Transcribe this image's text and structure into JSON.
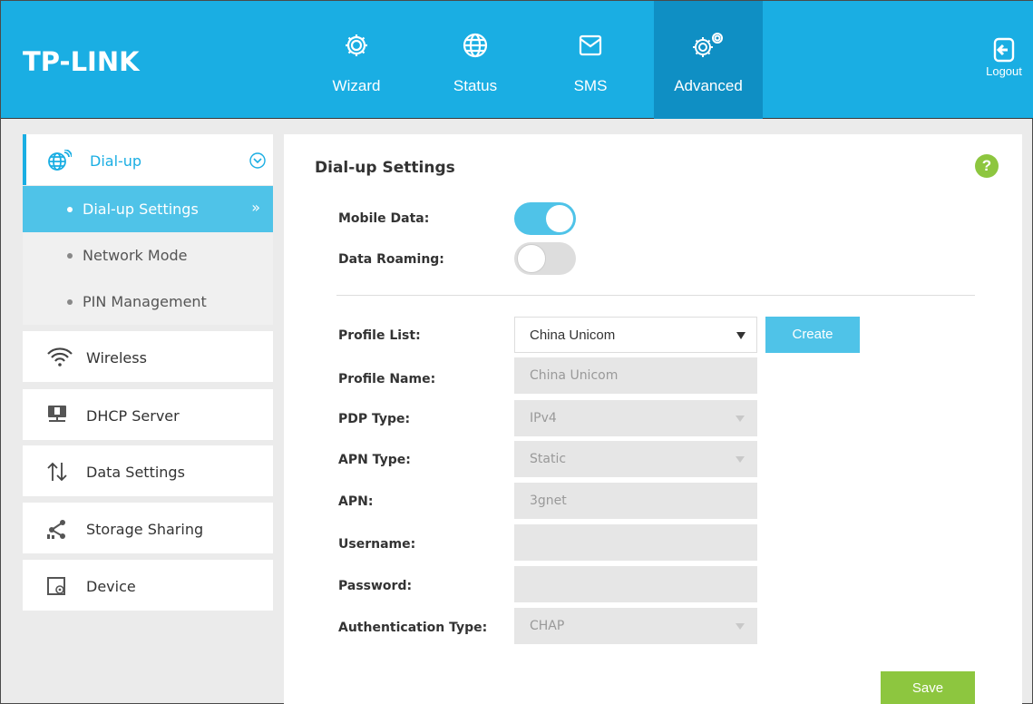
{
  "header": {
    "logo": "TP-LINK",
    "nav": [
      {
        "label": "Wizard",
        "icon": "gear-icon"
      },
      {
        "label": "Status",
        "icon": "globe-icon"
      },
      {
        "label": "SMS",
        "icon": "envelope-icon"
      },
      {
        "label": "Advanced",
        "icon": "gears-icon"
      }
    ],
    "logout_label": "Logout"
  },
  "sidebar": {
    "groups": [
      {
        "label": "Dial-up",
        "icon": "globe-signal-icon",
        "expanded": true
      },
      {
        "label": "Wireless",
        "icon": "wifi-icon"
      },
      {
        "label": "DHCP Server",
        "icon": "network-icon"
      },
      {
        "label": "Data Settings",
        "icon": "up-down-arrows-icon"
      },
      {
        "label": "Storage Sharing",
        "icon": "share-icon"
      },
      {
        "label": "Device",
        "icon": "device-settings-icon"
      }
    ],
    "sub_items": [
      {
        "label": "Dial-up Settings",
        "active": true
      },
      {
        "label": "Network Mode"
      },
      {
        "label": "PIN Management"
      }
    ]
  },
  "main": {
    "title": "Dial-up Settings",
    "help": "?",
    "mobile_data_label": "Mobile Data:",
    "data_roaming_label": "Data Roaming:",
    "profile_list_label": "Profile List:",
    "profile_list_value": "China Unicom",
    "create_label": "Create",
    "profile_name_label": "Profile Name:",
    "profile_name_value": "China Unicom",
    "pdp_type_label": "PDP Type:",
    "pdp_type_value": "IPv4",
    "apn_type_label": "APN Type:",
    "apn_type_value": "Static",
    "apn_label": "APN:",
    "apn_value": "3gnet",
    "username_label": "Username:",
    "username_value": "",
    "password_label": "Password:",
    "password_value": "",
    "auth_type_label": "Authentication Type:",
    "auth_type_value": "CHAP",
    "save_label": "Save"
  },
  "colors": {
    "header_bg": "#1aaee3",
    "nav_active_bg": "#0f8fc4",
    "accent": "#4fc3e8",
    "save_green": "#8dc63f"
  }
}
